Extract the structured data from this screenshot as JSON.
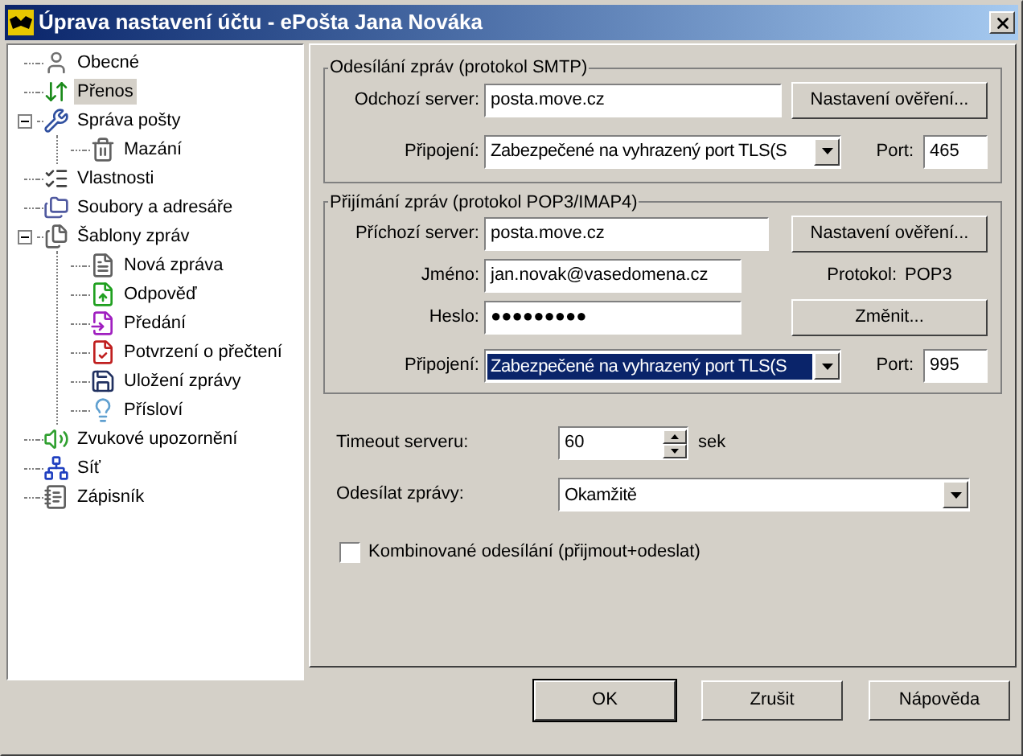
{
  "window": {
    "title": "Úprava nastavení účtu - ePošta Jana Nováka"
  },
  "tree": [
    {
      "label": "Obecné",
      "selected": false
    },
    {
      "label": "Přenos",
      "selected": true
    },
    {
      "label": "Správa pošty",
      "selected": false,
      "expanded": true,
      "children": [
        {
          "label": "Mazání",
          "selected": false
        }
      ]
    },
    {
      "label": "Vlastnosti",
      "selected": false
    },
    {
      "label": "Soubory a adresáře",
      "selected": false
    },
    {
      "label": "Šablony zpráv",
      "selected": false,
      "expanded": true,
      "children": [
        {
          "label": "Nová zpráva",
          "selected": false
        },
        {
          "label": "Odpověď",
          "selected": false
        },
        {
          "label": "Předání",
          "selected": false
        },
        {
          "label": "Potvrzení o přečtení",
          "selected": false
        },
        {
          "label": "Uložení zprávy",
          "selected": false
        },
        {
          "label": "Přísloví",
          "selected": false
        }
      ]
    },
    {
      "label": "Zvukové upozornění",
      "selected": false
    },
    {
      "label": "Síť",
      "selected": false
    },
    {
      "label": "Zápisník",
      "selected": false
    }
  ],
  "smtp": {
    "title": "Odesílání zpráv (protokol SMTP)",
    "server_label": "Odchozí server:",
    "server": "posta.move.cz",
    "auth_button": "Nastavení ověření...",
    "connection_label": "Připojení:",
    "connection": "Zabezpečené na vyhrazený port TLS(S",
    "connection_focused": false,
    "port_label": "Port:",
    "port": "465"
  },
  "pop3": {
    "title": "Přijímání zpráv (protokol POP3/IMAP4)",
    "server_label": "Příchozí server:",
    "server": "posta.move.cz",
    "auth_button": "Nastavení ověření...",
    "name_label": "Jméno:",
    "name": "jan.novak@vasedomena.cz",
    "protocol_label": "Protokol:",
    "protocol": "POP3",
    "password_label": "Heslo:",
    "password": "●●●●●●●●●",
    "change_button": "Změnit...",
    "connection_label": "Připojení:",
    "connection": "Zabezpečené na vyhrazený port TLS(S",
    "connection_focused": true,
    "port_label": "Port:",
    "port": "995"
  },
  "timeout": {
    "label": "Timeout serveru:",
    "value": "60",
    "unit": "sek"
  },
  "send": {
    "label": "Odesílat zprávy:",
    "value": "Okamžitě"
  },
  "combined": {
    "label": "Kombinované odesílání (přijmout+odeslat)",
    "checked": false
  },
  "buttons": [
    {
      "label": "OK",
      "default": true
    },
    {
      "label": "Zrušit",
      "default": false
    },
    {
      "label": "Nápověda",
      "default": false
    }
  ]
}
